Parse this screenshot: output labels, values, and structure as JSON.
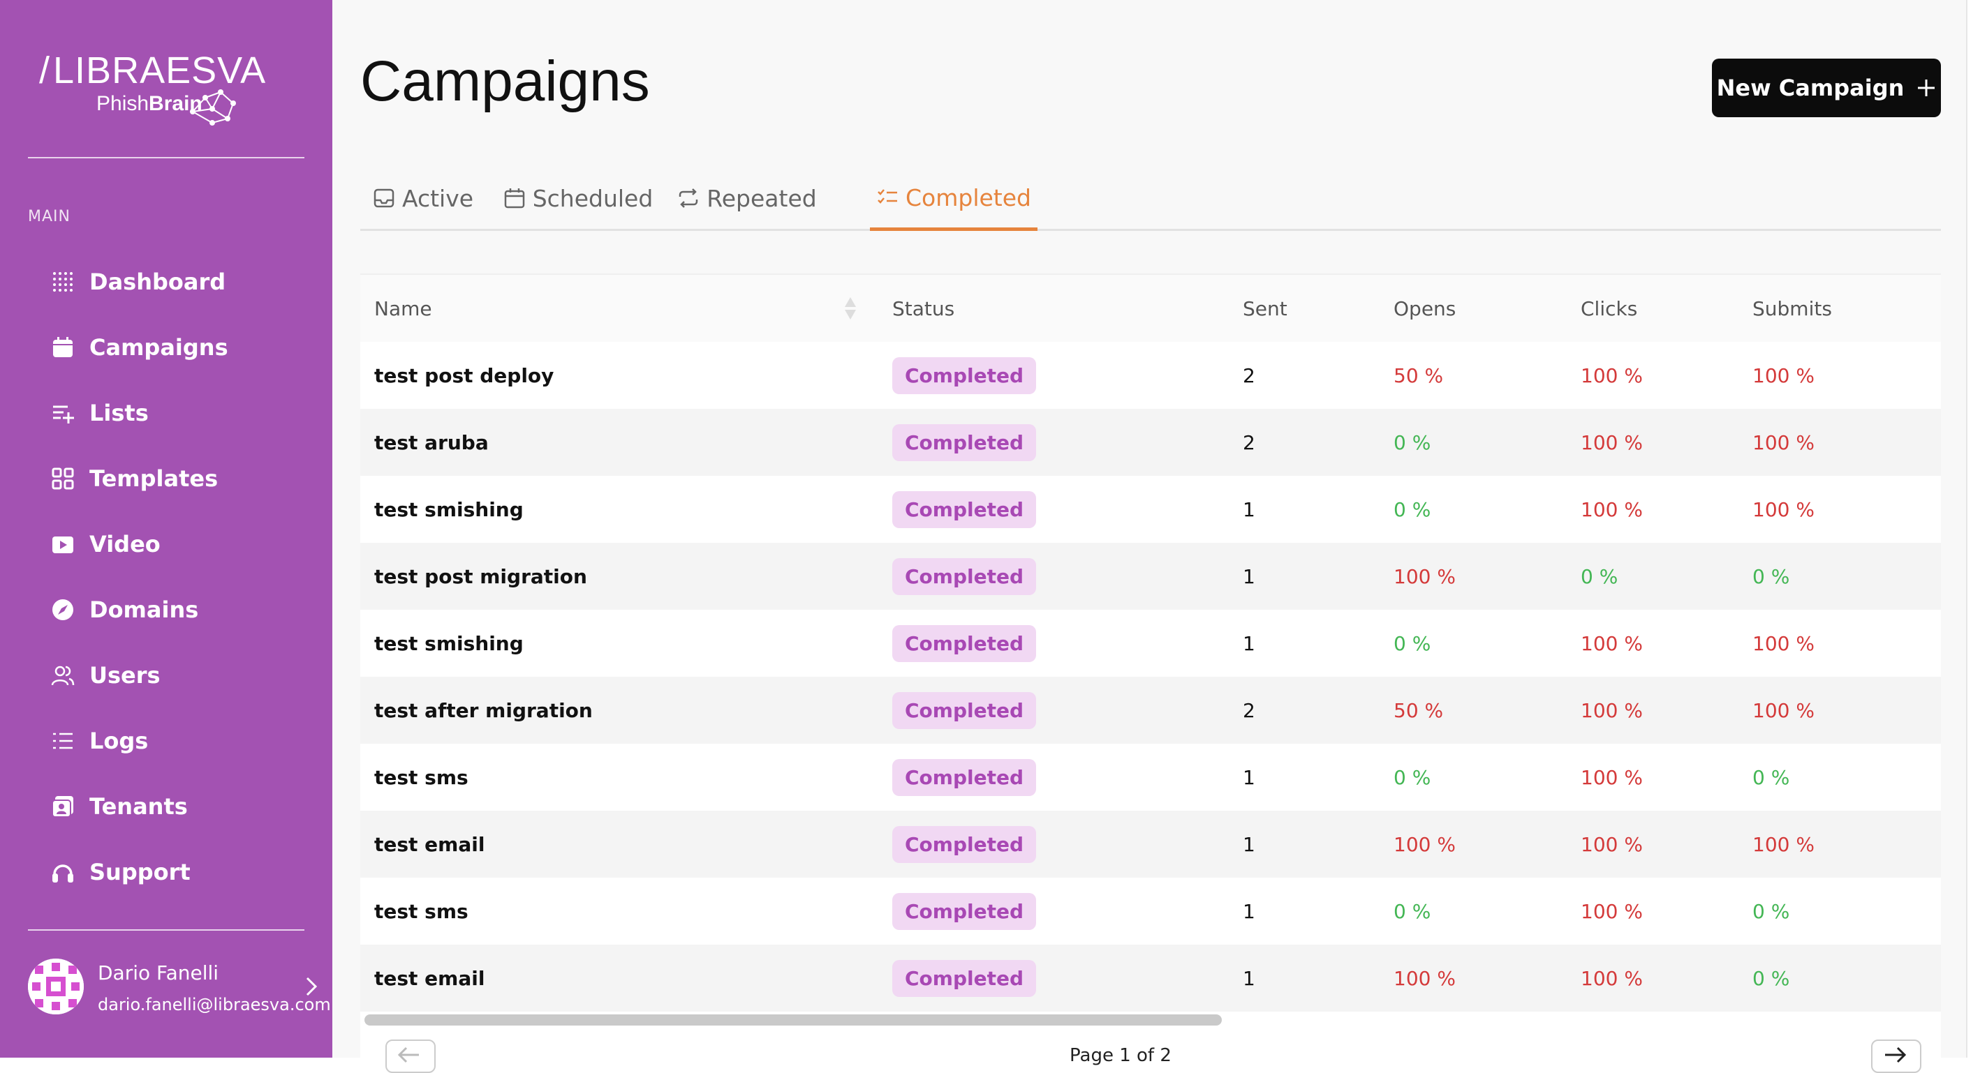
{
  "sidebar": {
    "logo_brand": "LIBRAESVA",
    "logo_sub_light": "Phish",
    "logo_sub_bold": "Brain",
    "section_label": "MAIN",
    "items": [
      {
        "label": "Dashboard",
        "icon": "dashboard-icon"
      },
      {
        "label": "Campaigns",
        "icon": "calendar-icon"
      },
      {
        "label": "Lists",
        "icon": "list-add-icon"
      },
      {
        "label": "Templates",
        "icon": "grid-icon"
      },
      {
        "label": "Video",
        "icon": "video-icon"
      },
      {
        "label": "Domains",
        "icon": "compass-icon"
      },
      {
        "label": "Users",
        "icon": "users-icon"
      },
      {
        "label": "Logs",
        "icon": "logs-icon"
      },
      {
        "label": "Tenants",
        "icon": "tenants-icon"
      },
      {
        "label": "Support",
        "icon": "headset-icon"
      }
    ],
    "user": {
      "name": "Dario Fanelli",
      "email": "dario.fanelli@libraesva.com"
    }
  },
  "header": {
    "title": "Campaigns",
    "new_button": "New Campaign"
  },
  "tabs": [
    {
      "label": "Active",
      "icon": "inbox-icon"
    },
    {
      "label": "Scheduled",
      "icon": "calendar-icon"
    },
    {
      "label": "Repeated",
      "icon": "repeat-icon"
    },
    {
      "label": "Completed",
      "icon": "checklist-icon"
    }
  ],
  "active_tab": "Completed",
  "table": {
    "columns": [
      "Name",
      "Status",
      "Sent",
      "Opens",
      "Clicks",
      "Submits"
    ],
    "rows": [
      {
        "name": "test post deploy",
        "status": "Completed",
        "sent": "2",
        "opens": "50 %",
        "clicks": "100 %",
        "submits": "100 %"
      },
      {
        "name": "test aruba",
        "status": "Completed",
        "sent": "2",
        "opens": "0 %",
        "clicks": "100 %",
        "submits": "100 %"
      },
      {
        "name": "test smishing",
        "status": "Completed",
        "sent": "1",
        "opens": "0 %",
        "clicks": "100 %",
        "submits": "100 %"
      },
      {
        "name": "test post migration",
        "status": "Completed",
        "sent": "1",
        "opens": "100 %",
        "clicks": "0 %",
        "submits": "0 %"
      },
      {
        "name": "test smishing",
        "status": "Completed",
        "sent": "1",
        "opens": "0 %",
        "clicks": "100 %",
        "submits": "100 %"
      },
      {
        "name": "test after migration",
        "status": "Completed",
        "sent": "2",
        "opens": "50 %",
        "clicks": "100 %",
        "submits": "100 %"
      },
      {
        "name": "test sms",
        "status": "Completed",
        "sent": "1",
        "opens": "0 %",
        "clicks": "100 %",
        "submits": "0 %"
      },
      {
        "name": "test email",
        "status": "Completed",
        "sent": "1",
        "opens": "100 %",
        "clicks": "100 %",
        "submits": "100 %"
      },
      {
        "name": "test sms",
        "status": "Completed",
        "sent": "1",
        "opens": "0 %",
        "clicks": "100 %",
        "submits": "0 %"
      },
      {
        "name": "test email",
        "status": "Completed",
        "sent": "1",
        "opens": "100 %",
        "clicks": "100 %",
        "submits": "0 %"
      }
    ]
  },
  "pagination": {
    "label": "Page 1 of 2"
  },
  "colors": {
    "sidebar_bg": "#a352b2",
    "accent": "#e6843d",
    "badge_bg": "#f1d8f3",
    "badge_text": "#a848b4",
    "pct_bad": "#d43a3a",
    "pct_good": "#43b654"
  }
}
